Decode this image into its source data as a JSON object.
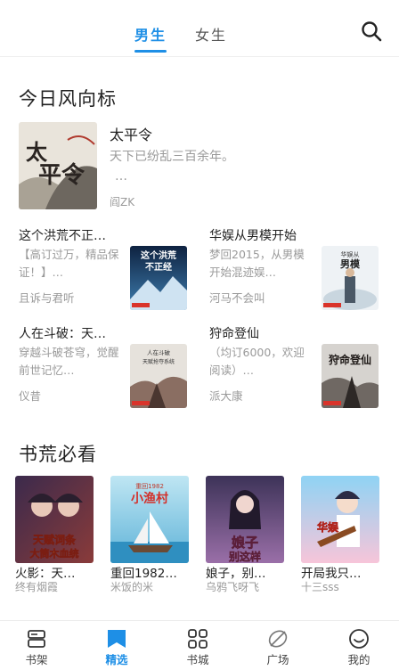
{
  "top_tabs": {
    "male": "男生",
    "female": "女生",
    "active": "male"
  },
  "icons": {
    "search": "search-icon"
  },
  "colors": {
    "accent": "#1e8fe6",
    "text": "#222222",
    "muted": "#9a9a9a"
  },
  "section_trend": {
    "title": "今日风向标",
    "featured": {
      "title": "太平令",
      "desc": "天下已纷乱三百余年。",
      "ellipsis": "…",
      "author": "阎ZK",
      "cover_text": "太平令"
    },
    "cards": [
      {
        "title": "这个洪荒不正…",
        "desc": "【高订过万，精品保证！】…",
        "author": "且诉与君听",
        "cover_text": "这个洪荒不正经"
      },
      {
        "title": "华娱从男模开始",
        "desc": "梦回2015，从男模开始混迹娱…",
        "author": "河马不会叫",
        "cover_text": "华娱从男模开始"
      },
      {
        "title": "人在斗破：天…",
        "desc": "穿越斗破苍穹，觉醒前世记忆…",
        "author": "仪昔",
        "cover_text": "人在斗破天赋抢夺系统"
      },
      {
        "title": "狩命登仙",
        "desc": "（均订6000，欢迎阅读）…",
        "author": "派大康",
        "cover_text": "狩命登仙"
      }
    ]
  },
  "section_must_read": {
    "title": "书荒必看",
    "books": [
      {
        "title": "火影：天…",
        "author": "终有烟霞",
        "cover_text": "天赋词条大筒木血统"
      },
      {
        "title": "重回1982…",
        "author": "米饭的米",
        "cover_text": "小渔村",
        "cover_sub": "重回1982"
      },
      {
        "title": "娘子，别…",
        "author": "乌鸦飞呀飞",
        "cover_text": "娘子别这样"
      },
      {
        "title": "开局我只…",
        "author": "十三sss",
        "cover_text": "华娱"
      }
    ]
  },
  "bottom_nav": [
    {
      "label": "书架",
      "icon": "bookshelf-icon"
    },
    {
      "label": "精选",
      "icon": "bookmark-icon",
      "active": true
    },
    {
      "label": "书城",
      "icon": "grid-icon"
    },
    {
      "label": "广场",
      "icon": "leaf-icon"
    },
    {
      "label": "我的",
      "icon": "smile-icon"
    }
  ]
}
